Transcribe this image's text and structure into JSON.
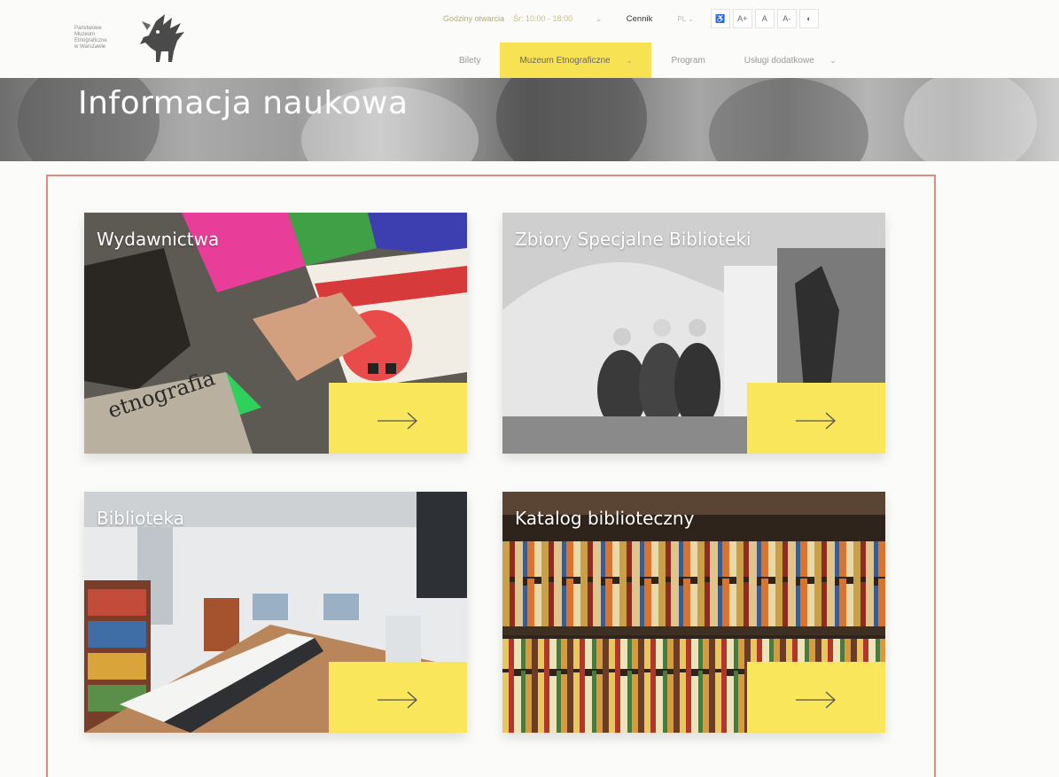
{
  "logo": {
    "lines": [
      "Państwowe",
      "Muzeum",
      "Etnograficzne",
      "w Warszawie"
    ]
  },
  "topbar": {
    "hours_label": "Godziny otwarcia",
    "hours_value": "Śr: 10:00 - 18:00",
    "pricing": "Cennik",
    "language": "PL",
    "accessibility": [
      "A+",
      "A",
      "A-"
    ]
  },
  "nav": {
    "items": [
      {
        "label": "Bilety"
      },
      {
        "label": "Muzeum Etnograficzne"
      },
      {
        "label": "Program"
      },
      {
        "label": "Usługi dodatkowe"
      }
    ]
  },
  "hero": {
    "title": "Informacja naukowa"
  },
  "cards": [
    {
      "title": "Wydawnictwa",
      "overlay_text": "etnografia"
    },
    {
      "title": "Zbiory Specjalne Biblioteki"
    },
    {
      "title": "Biblioteka"
    },
    {
      "title": "Katalog biblioteczny"
    }
  ],
  "colors": {
    "accent": "#f7e254",
    "frame": "#e08a84",
    "background": "#fbfbf9"
  }
}
